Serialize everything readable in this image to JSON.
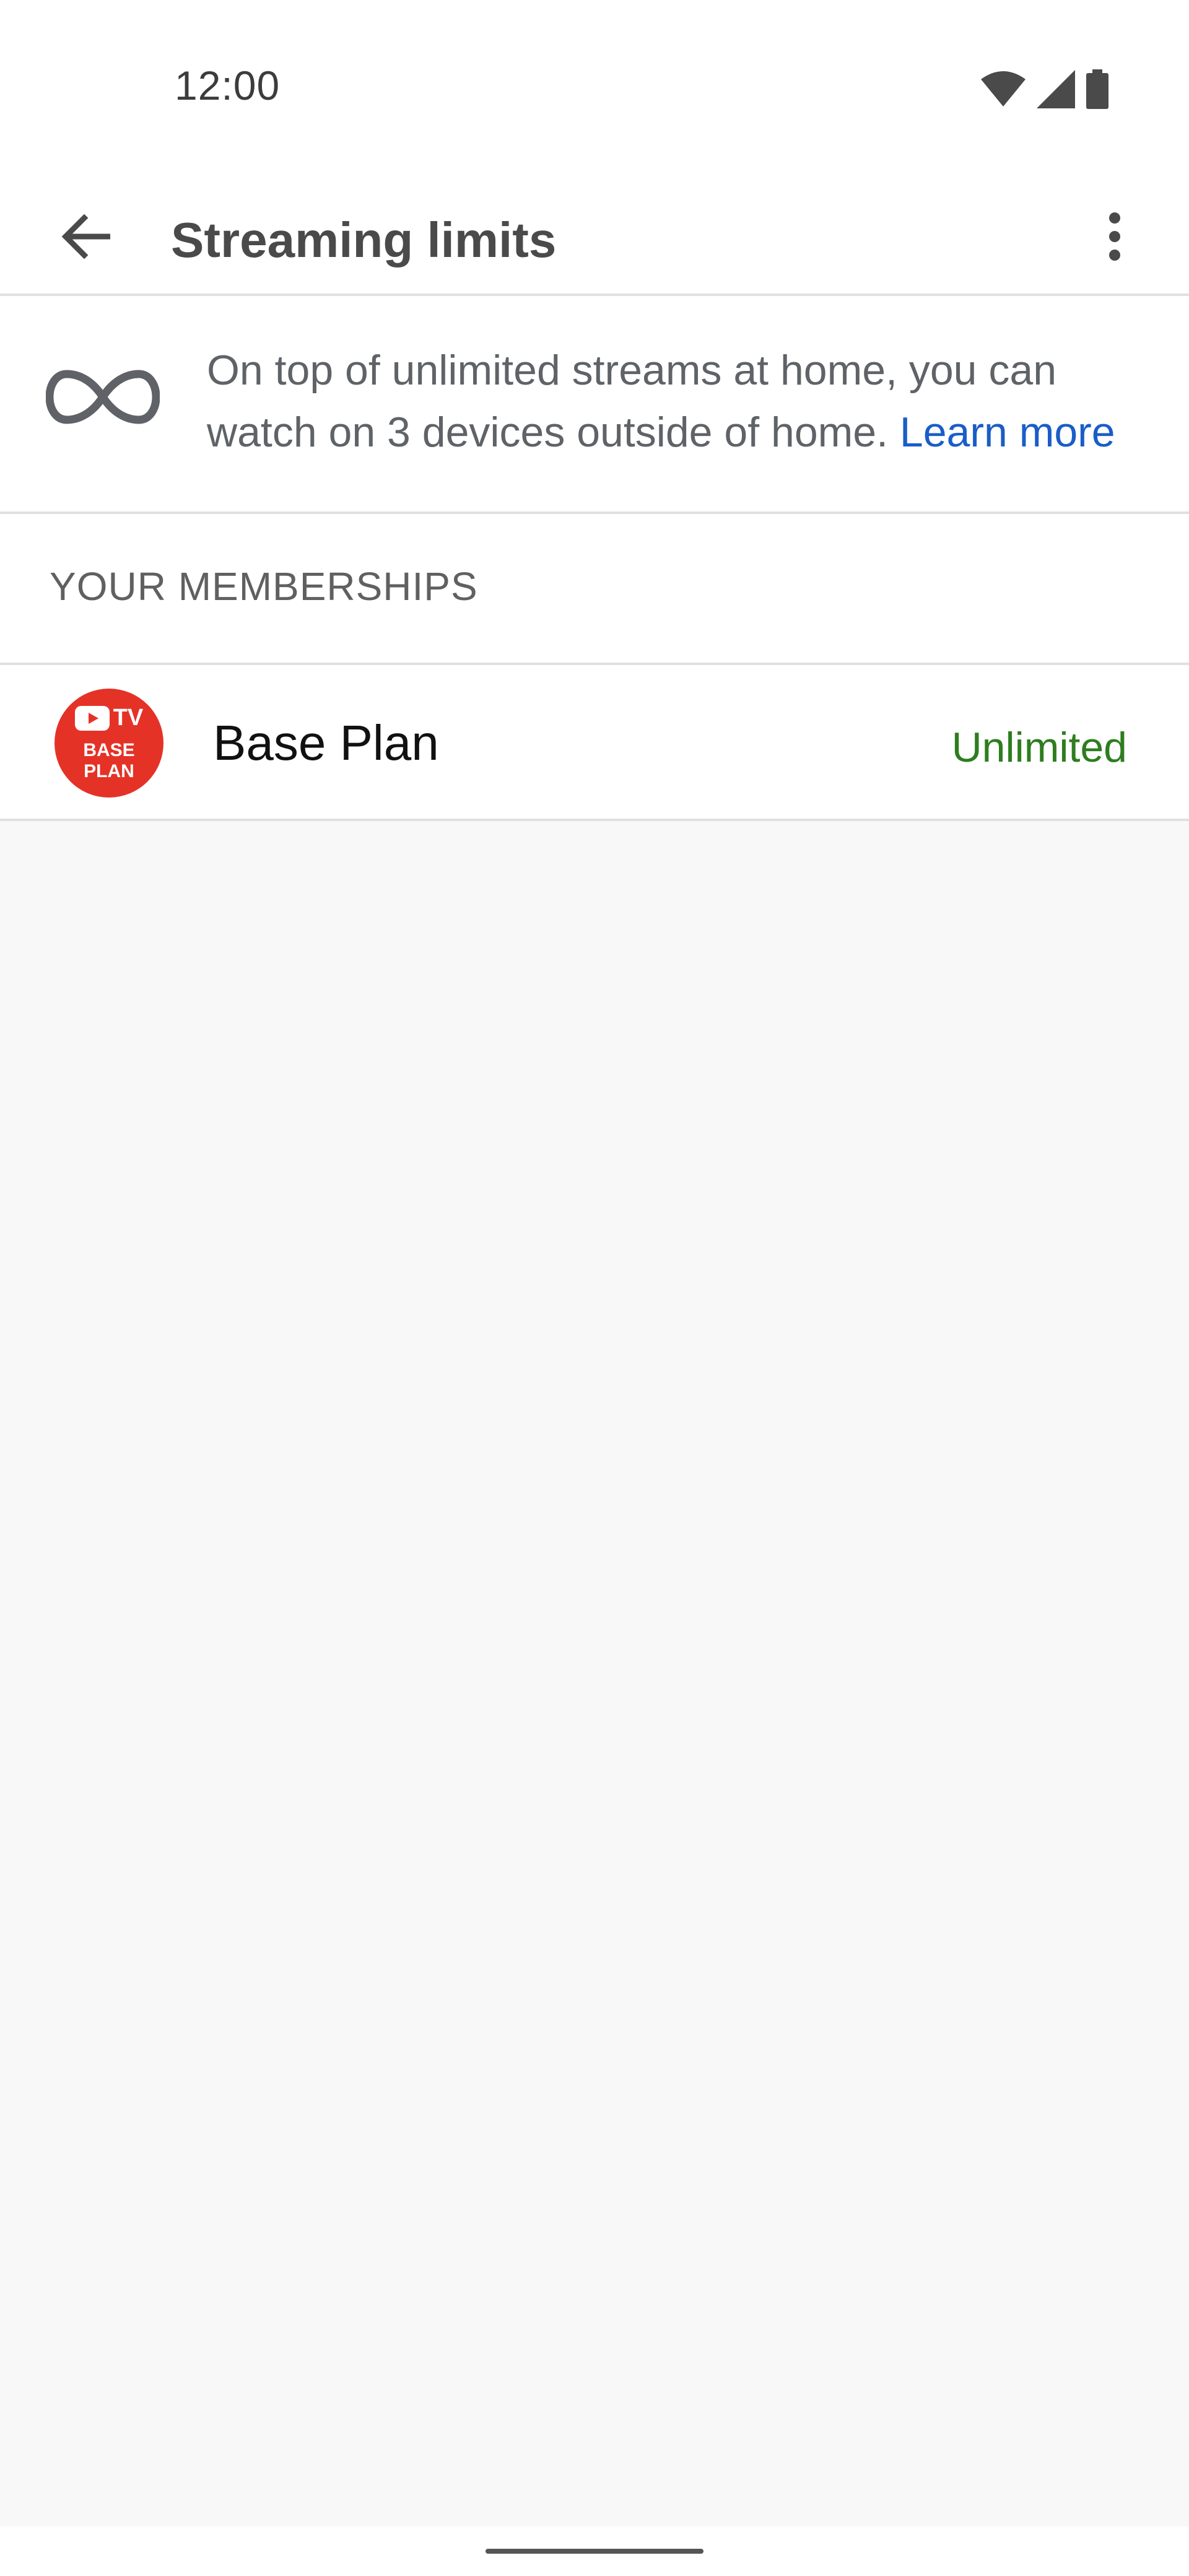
{
  "status_bar": {
    "time": "12:00",
    "icons": [
      "wifi-icon",
      "signal-icon",
      "battery-icon"
    ]
  },
  "app_bar": {
    "title": "Streaming limits",
    "back_icon": "arrow-back-icon",
    "overflow_icon": "more-vert-icon"
  },
  "info": {
    "icon": "infinity-icon",
    "text": "On top of unlimited streams at home, you can watch on 3 devices outside of home.",
    "link_label": "Learn more",
    "link_color": "#1a5dc8"
  },
  "memberships": {
    "header": "YOUR MEMBERSHIPS",
    "items": [
      {
        "logo": {
          "tv_label": "TV",
          "line1": "BASE",
          "line2": "PLAN",
          "color": "#e53227"
        },
        "name": "Base Plan",
        "status": "Unlimited",
        "status_color": "#2e7d1f"
      }
    ]
  }
}
